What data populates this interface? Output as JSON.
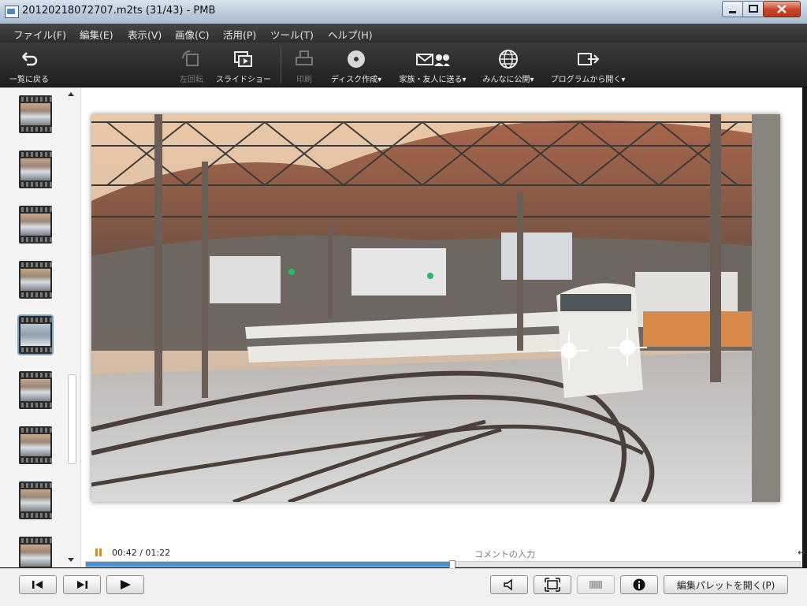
{
  "window": {
    "title": "20120218072707.m2ts (31/43)  - PMB"
  },
  "menu": {
    "items": [
      "ファイル(F)",
      "編集(E)",
      "表示(V)",
      "画像(C)",
      "活用(P)",
      "ツール(T)",
      "ヘルプ(H)"
    ]
  },
  "toolbar": {
    "back": "一覧に戻る",
    "rotate_left": "左回転",
    "slideshow": "スライドショー",
    "print": "印刷",
    "disc": "ディスク作成",
    "send": "家族・友人に送る",
    "publish": "みんなに公開",
    "open_with": "プログラムから開く",
    "dropdown_glyph": "▾",
    "disabled": [
      "rotate_left",
      "print"
    ]
  },
  "sidebar": {
    "thumbnail_count": 9,
    "selected_index": 4
  },
  "player": {
    "current_time": "00:42",
    "duration": "01:22",
    "time_display": "00:42 / 01:22",
    "progress_fraction": 0.512,
    "comment_placeholder": "コメントの入力",
    "state": "playing"
  },
  "bottom": {
    "edit_palette_label": "編集パレットを開く(P)"
  },
  "colors": {
    "accent": "#4a90d2",
    "play_indicator": "#e8871e",
    "menubar": "#2e2e2e",
    "close_button": "#c7452c"
  },
  "icons": [
    "app-icon",
    "back-arrow-icon",
    "rotate-left-icon",
    "slideshow-icon",
    "print-icon",
    "disc-icon",
    "send-mail-icon",
    "globe-icon",
    "open-program-icon",
    "first-frame-icon",
    "last-frame-icon",
    "play-icon",
    "volume-icon",
    "fit-screen-icon",
    "film-strip-icon",
    "info-icon"
  ]
}
